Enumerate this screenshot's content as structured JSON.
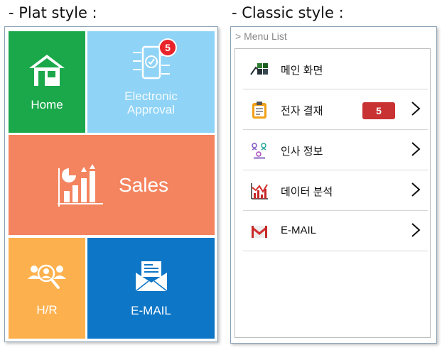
{
  "captions": {
    "plat": "- Plat style :",
    "classic": "- Classic style :"
  },
  "plat": {
    "tiles": {
      "home": {
        "label": "Home",
        "icon": "house-icon",
        "color": "#1aa84a"
      },
      "approval": {
        "label_line1": "Electronic",
        "label_line2": "Approval",
        "icon": "approval-tablet-icon",
        "badge": "5",
        "color": "#8fd3f6"
      },
      "sales": {
        "label": "Sales",
        "icon": "bar-chart-icon",
        "color": "#f4845f"
      },
      "hr": {
        "label": "H/R",
        "icon": "people-search-icon",
        "color": "#fdb14e"
      },
      "email": {
        "label": "E-MAIL",
        "icon": "envelope-icon",
        "color": "#0e76c7"
      }
    }
  },
  "classic": {
    "title": "> Menu List",
    "items": [
      {
        "label": "메인 화면",
        "icon": "main-screen-icon",
        "chevron": false
      },
      {
        "label": "전자 결재",
        "icon": "clipboard-icon",
        "badge": "5",
        "chevron": true
      },
      {
        "label": "인사 정보",
        "icon": "hr-info-icon",
        "chevron": true
      },
      {
        "label": "데이터 분석",
        "icon": "data-chart-icon",
        "chevron": true
      },
      {
        "label": "E-MAIL",
        "icon": "gmail-icon",
        "chevron": true
      }
    ]
  }
}
